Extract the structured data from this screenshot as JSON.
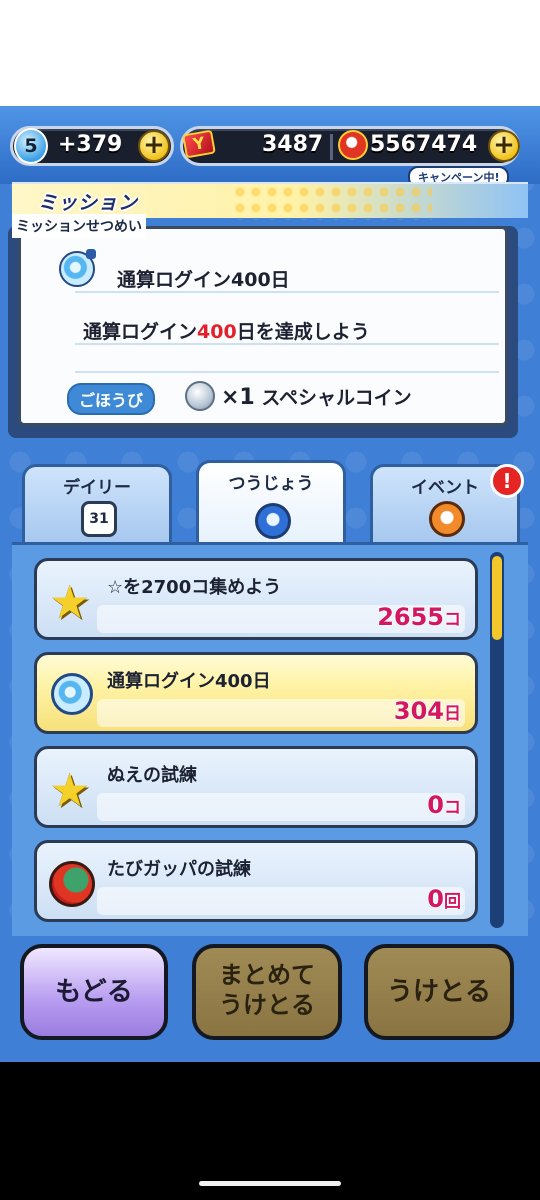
{
  "currency": {
    "stamina_level": "5",
    "stamina_value": "+379",
    "tickets": "3487",
    "money": "5567474",
    "campaign_label": "キャンペーン中!"
  },
  "mission_header": {
    "title": "ミッション"
  },
  "description": {
    "label": "ミッションせつめい",
    "mission_title": "通算ログイン400日",
    "text_before": "通算ログイン",
    "text_highlight": "400",
    "text_after": "日を達成しよう",
    "reward_label": "ごほうび",
    "reward_count": "×1",
    "reward_name": "スペシャルコイン"
  },
  "tabs": [
    {
      "label": "デイリー",
      "icon": "calendar-icon",
      "icon_text": "31"
    },
    {
      "label": "つうじょう",
      "icon": "blue-flag-icon"
    },
    {
      "label": "イベント",
      "icon": "orange-flag-icon"
    }
  ],
  "alert_badge": "!",
  "missions": [
    {
      "title": "☆を2700コ集めよう",
      "progress": "2655",
      "unit": "コ",
      "icon": "star-icon",
      "highlighted": false
    },
    {
      "title": "通算ログイン400日",
      "progress": "304",
      "unit": "日",
      "icon": "bomb-icon",
      "highlighted": true
    },
    {
      "title": "ぬえの試練",
      "progress": "0",
      "unit": "コ",
      "icon": "star-icon",
      "highlighted": false
    },
    {
      "title": "たびガッパの試練",
      "progress": "0",
      "unit": "回",
      "icon": "gappa-icon",
      "highlighted": false
    }
  ],
  "buttons": {
    "back": "もどる",
    "receive_all_line1": "まとめて",
    "receive_all_line2": "うけとる",
    "receive": "うけとる"
  },
  "colors": {
    "background": "#3f7fd6",
    "highlight_row": "#fff3a6",
    "progress_text": "#d31760",
    "alert": "#e52424"
  }
}
